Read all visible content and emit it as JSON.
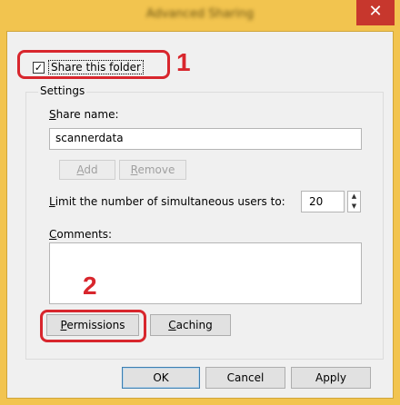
{
  "window": {
    "title": "Advanced Sharing",
    "close_label": "✕"
  },
  "share_checkbox": {
    "checked": true,
    "label": "Share this folder"
  },
  "settings": {
    "group_title": "Settings",
    "share_name_label": "Share name:",
    "share_name_value": "scannerdata",
    "add_label": "Add",
    "remove_label": "Remove",
    "limit_label": "Limit the number of simultaneous users to:",
    "limit_value": "20",
    "comments_label": "Comments:",
    "comments_value": "",
    "permissions_label": "Permissions",
    "caching_label": "Caching"
  },
  "annotations": {
    "step1": "1",
    "step2": "2",
    "color": "#d8262d"
  },
  "footer": {
    "ok_label": "OK",
    "cancel_label": "Cancel",
    "apply_label": "Apply"
  },
  "colors": {
    "title_bar": "#f2c44f",
    "close_button": "#c7372d",
    "dialog_bg": "#f0f0f0"
  }
}
